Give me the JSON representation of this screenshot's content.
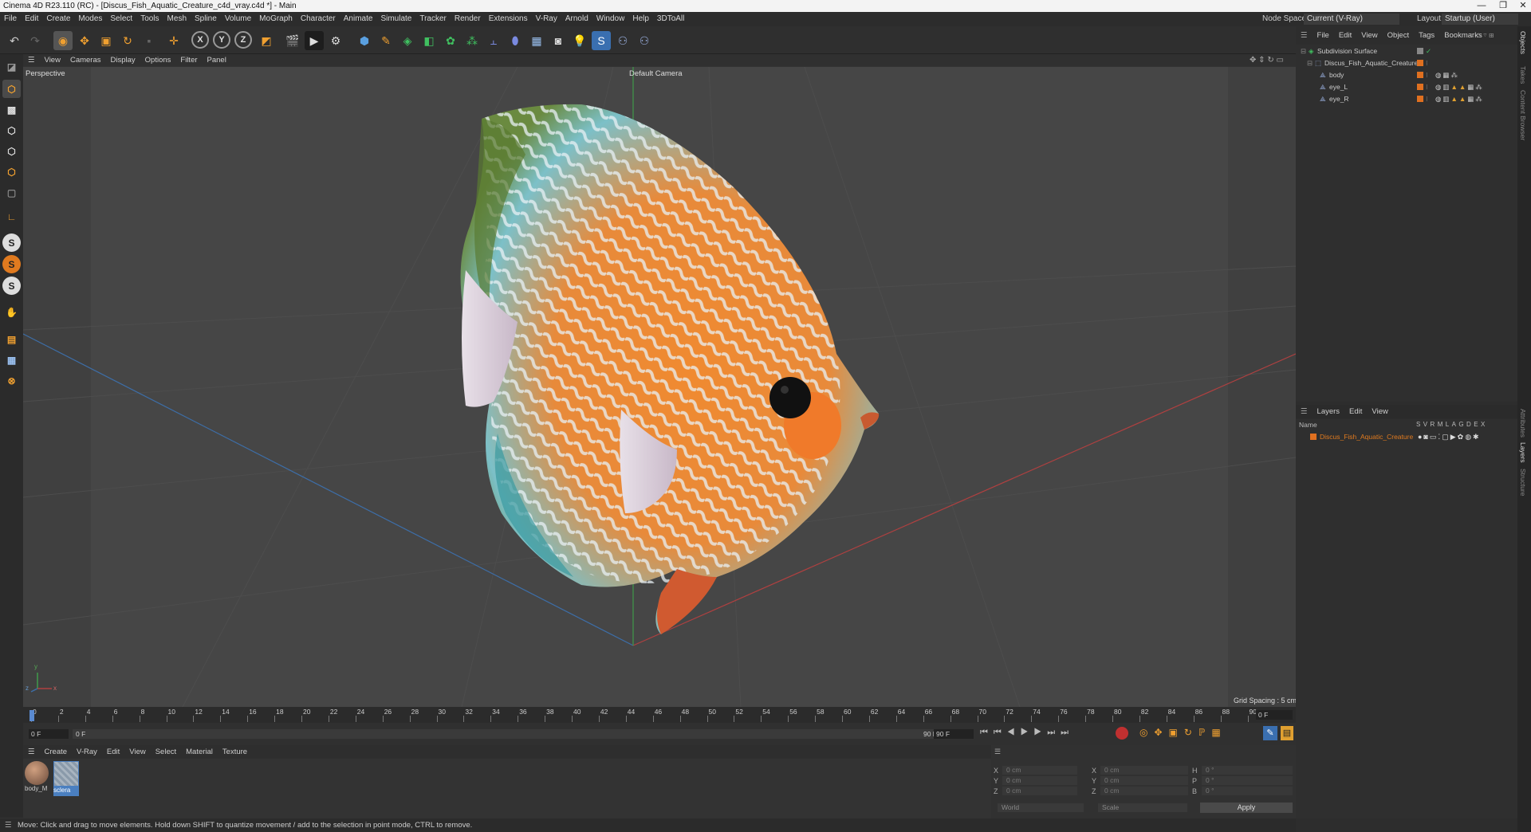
{
  "window": {
    "title": "Cinema 4D R23.110 (RC) - [Discus_Fish_Aquatic_Creature_c4d_vray.c4d *] - Main",
    "minimize": "—",
    "maximize": "❐",
    "close": "✕"
  },
  "menubar": {
    "items": [
      "File",
      "Edit",
      "Create",
      "Modes",
      "Select",
      "Tools",
      "Mesh",
      "Spline",
      "Volume",
      "MoGraph",
      "Character",
      "Animate",
      "Simulate",
      "Tracker",
      "Render",
      "Extensions",
      "V-Ray",
      "Arnold",
      "Window",
      "Help",
      "3DToAll"
    ],
    "node_space_label": "Node Space:",
    "node_space_value": "Current (V-Ray)",
    "layout_label": "Layout:",
    "layout_value": "Startup (User)"
  },
  "viewport": {
    "menu": [
      "View",
      "Cameras",
      "Display",
      "Options",
      "Filter",
      "Panel"
    ],
    "view_name": "Perspective",
    "camera_label": "Default Camera",
    "grid_spacing": "Grid Spacing : 5 cm",
    "axis_y": "y",
    "axis_z": "z",
    "axis_x": "x"
  },
  "timeline": {
    "ticks": [
      "0",
      "2",
      "4",
      "6",
      "8",
      "10",
      "12",
      "14",
      "16",
      "18",
      "20",
      "22",
      "24",
      "26",
      "28",
      "30",
      "32",
      "34",
      "36",
      "38",
      "40",
      "42",
      "44",
      "46",
      "48",
      "50",
      "52",
      "54",
      "56",
      "58",
      "60",
      "62",
      "64",
      "66",
      "68",
      "70",
      "72",
      "74",
      "76",
      "78",
      "80",
      "82",
      "84",
      "86",
      "88",
      "90"
    ],
    "current_frame": "0 F",
    "start_frame": "0 F",
    "range_start": "0 F",
    "range_end": "90 F",
    "end_frame": "90 F"
  },
  "materials": {
    "menu": [
      "Create",
      "V-Ray",
      "Edit",
      "View",
      "Select",
      "Material",
      "Texture"
    ],
    "items": [
      {
        "label": "body_M",
        "color": "#6a4a3a"
      },
      {
        "label": "sclera",
        "color": "#8a9aaa"
      }
    ]
  },
  "coords": {
    "x_label": "X",
    "y_label": "Y",
    "z_label": "Z",
    "x_pos": "0 cm",
    "y_pos": "0 cm",
    "z_pos": "0 cm",
    "x2_label": "X",
    "y2_label": "Y",
    "z2_label": "Z",
    "x_size": "0 cm",
    "y_size": "0 cm",
    "z_size": "0 cm",
    "h_label": "H",
    "p_label": "P",
    "b_label": "B",
    "h_val": "0 °",
    "p_val": "0 °",
    "b_val": "0 °",
    "mode": "World",
    "size_mode": "Scale",
    "apply": "Apply"
  },
  "objects": {
    "menu": [
      "File",
      "Edit",
      "View",
      "Object",
      "Tags",
      "Bookmarks"
    ],
    "items": [
      {
        "label": "Subdivision Surface",
        "indent": 0
      },
      {
        "label": "Discus_Fish_Aquatic_Creature",
        "indent": 1
      },
      {
        "label": "body",
        "indent": 2
      },
      {
        "label": "eye_L",
        "indent": 2
      },
      {
        "label": "eye_R",
        "indent": 2
      }
    ]
  },
  "layers": {
    "menu": [
      "Layers",
      "Edit",
      "View"
    ],
    "name_header": "Name",
    "flags": [
      "S",
      "V",
      "R",
      "M",
      "L",
      "A",
      "G",
      "D",
      "E",
      "X"
    ],
    "items": [
      {
        "label": "Discus_Fish_Aquatic_Creature",
        "color": "#e07020"
      }
    ]
  },
  "side_tabs": [
    "Objects",
    "Takes",
    "Content Browser",
    "Attributes",
    "Layers",
    "Structure"
  ],
  "status": "Move: Click and drag to move elements. Hold down SHIFT to quantize movement / add to the selection in point mode, CTRL to remove.",
  "colors": {
    "accent_orange": "#e07a1f",
    "selection_blue": "#4a7fc0"
  }
}
